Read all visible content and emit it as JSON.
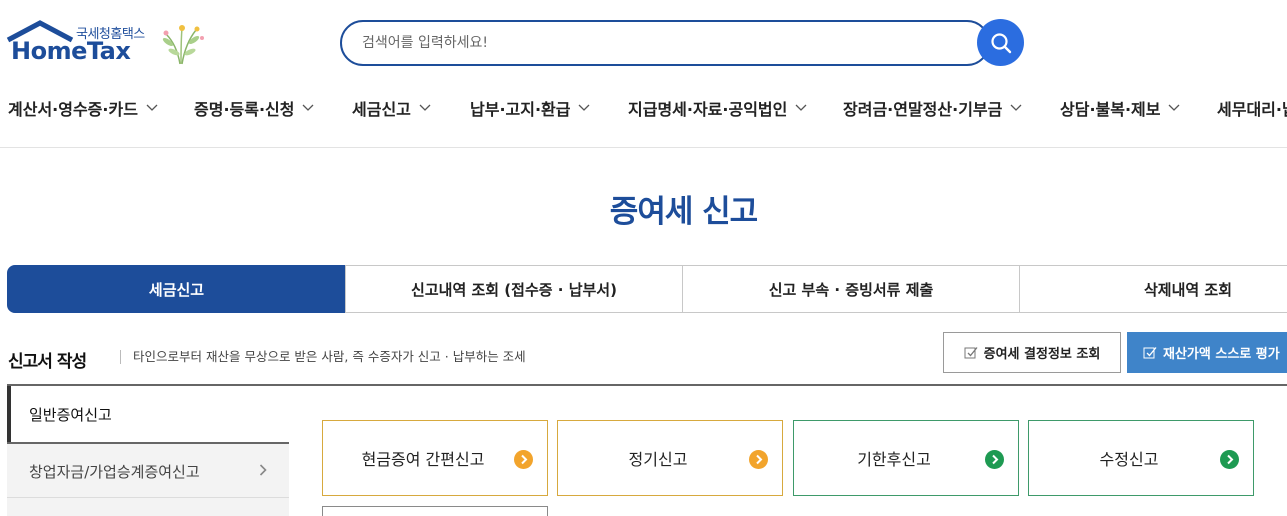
{
  "header": {
    "logo_sub": "국세청홈택스",
    "logo_main": "HomeTax",
    "search_placeholder": "검색어를 입력하세요!"
  },
  "gnb": [
    {
      "label": "계산서·영수증·카드"
    },
    {
      "label": "증명·등록·신청"
    },
    {
      "label": "세금신고"
    },
    {
      "label": "납부·고지·환급"
    },
    {
      "label": "지급명세·자료·공익법인"
    },
    {
      "label": "장려금·연말정산·기부금"
    },
    {
      "label": "상담·불복·제보"
    },
    {
      "label": "세무대리·납"
    }
  ],
  "page_title": "증여세 신고",
  "tabs": [
    {
      "label": "세금신고",
      "active": true
    },
    {
      "label": "신고내역 조회 (접수증 · 납부서)"
    },
    {
      "label": "신고 부속 · 증빙서류 제출"
    },
    {
      "label": "삭제내역 조회"
    }
  ],
  "section": {
    "title": "신고서 작성",
    "description": "타인으로부터 재산을 무상으로 받은 사람, 즉 수증자가 신고 · 납부하는 조세",
    "btn_outline": "증여세 결정정보 조회",
    "btn_blue": "재산가액 스스로 평가"
  },
  "side_menu": {
    "active": "일반증여신고",
    "items": [
      "창업자금/가업승계증여신고"
    ]
  },
  "cards": [
    {
      "label": "현금증여 간편신고",
      "style": "orange"
    },
    {
      "label": "정기신고",
      "style": "orange"
    },
    {
      "label": "기한후신고",
      "style": "green"
    },
    {
      "label": "수정신고",
      "style": "green"
    }
  ],
  "colors": {
    "brand": "#1d4d9a",
    "search_button": "#2b6de0",
    "accent_orange": "#f2a42c",
    "accent_green": "#1e9a52",
    "button_blue": "#3f84c9"
  }
}
